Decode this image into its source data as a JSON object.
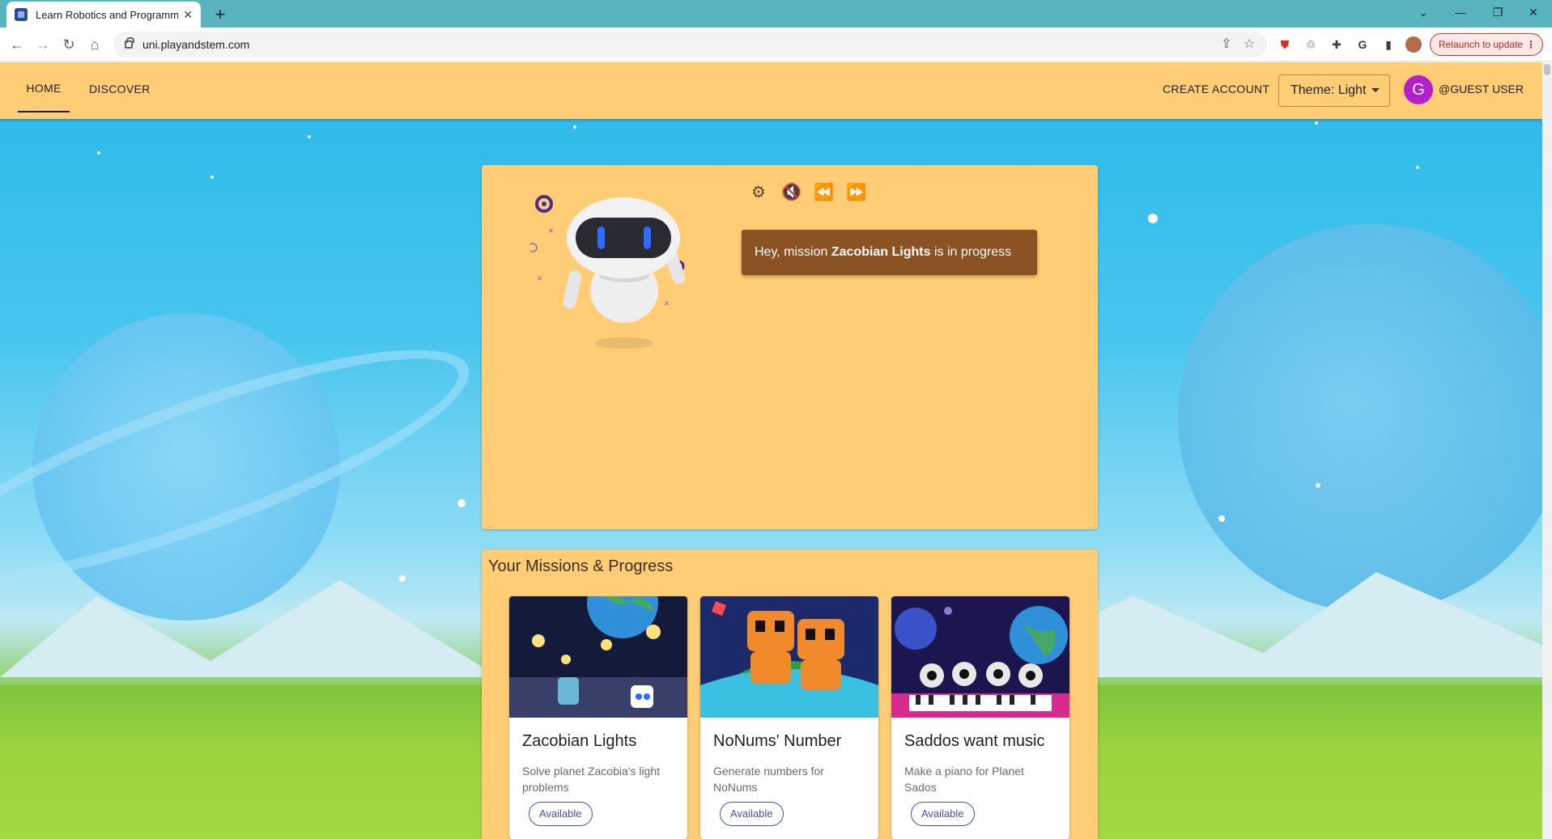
{
  "browser": {
    "tab_title": "Learn Robotics and Programmin",
    "url": "uni.playandstem.com",
    "relaunch_label": "Relaunch to update",
    "icons": [
      "back-icon",
      "forward-icon",
      "reload-icon",
      "home-icon",
      "share-icon",
      "star-icon",
      "extensions-icon",
      "google-icon",
      "sidepanel-icon",
      "menu-icon"
    ]
  },
  "appbar": {
    "home": "HOME",
    "discover": "DISCOVER",
    "create_account": "CREATE ACCOUNT",
    "theme": "Theme: Light",
    "avatar_initial": "G",
    "user": "@GUEST USER"
  },
  "assistant": {
    "message_prefix": "Hey, mission ",
    "mission_name": "Zacobian Lights",
    "message_suffix": " is in progress",
    "controls": [
      "settings-icon",
      "volume-muted-icon",
      "rewind-icon",
      "fast-forward-icon"
    ]
  },
  "missions": {
    "title": "Your Missions & Progress",
    "cards": [
      {
        "title": "Zacobian Lights",
        "description": "Solve planet Zacobia's light problems",
        "status": "Available"
      },
      {
        "title": "NoNums' Number",
        "description": "Generate numbers for NoNums",
        "status": "Available"
      },
      {
        "title": "Saddos want music",
        "description": "Make a piano for Planet Sados",
        "status": "Available"
      }
    ]
  },
  "colors": {
    "appbar": "#ffcd75",
    "speech_bubble": "#8b5224",
    "avatar": "#b31fc9",
    "chip": "#3f51b5",
    "tabstrip": "#5ab4bf"
  }
}
